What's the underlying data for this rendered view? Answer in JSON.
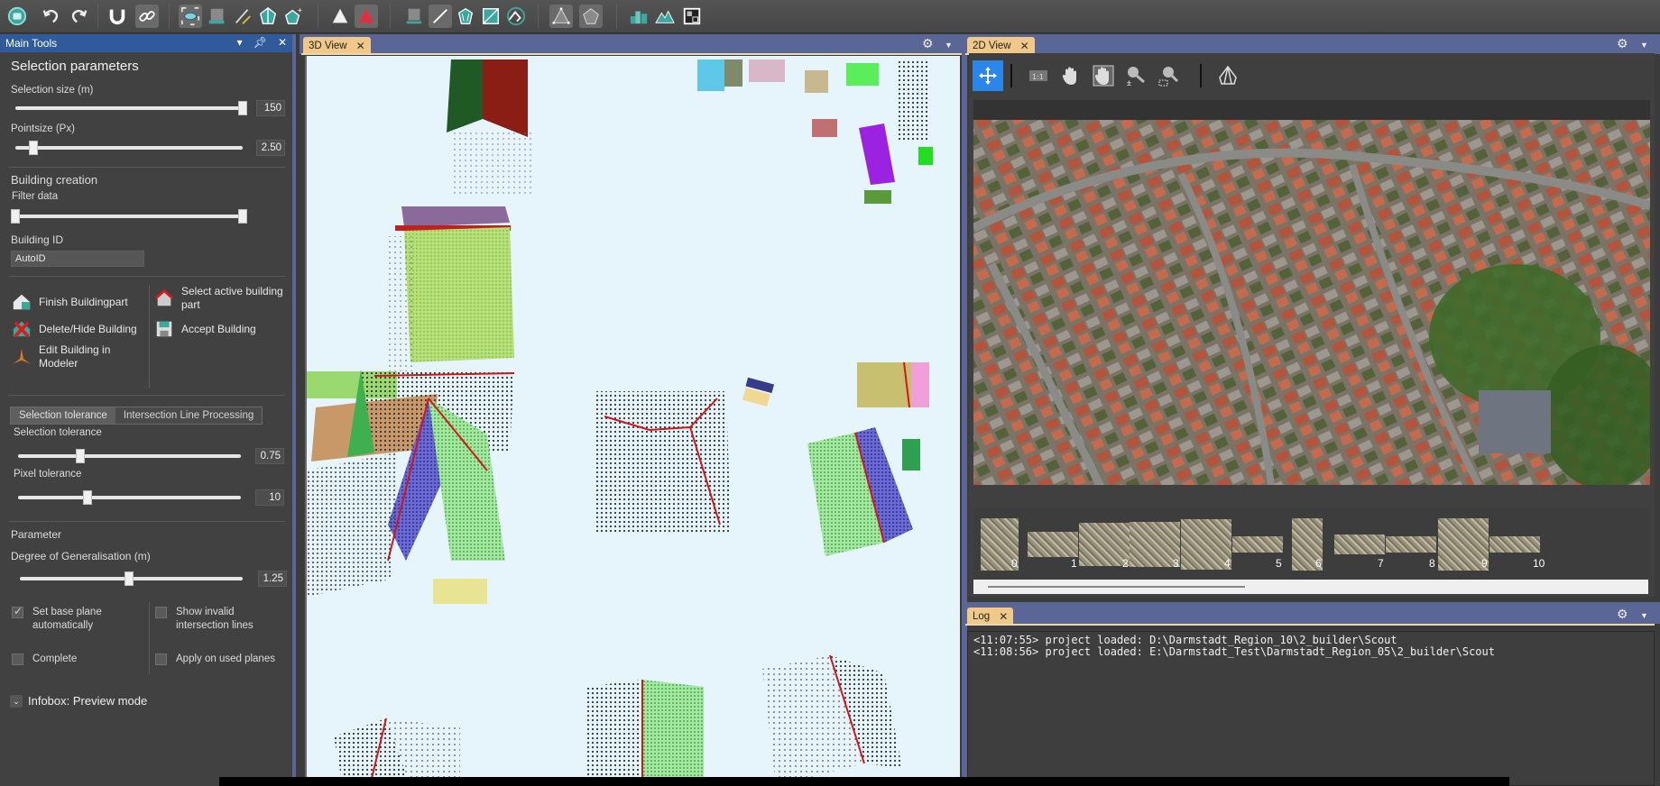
{
  "toolbar": {
    "buttons": [
      {
        "name": "app-logo",
        "icon": "sphere-icon"
      },
      {
        "name": "undo",
        "icon": "undo-icon"
      },
      {
        "name": "redo",
        "icon": "redo-icon"
      },
      {
        "name": "snap",
        "icon": "magnet-icon"
      },
      {
        "name": "link",
        "icon": "link-icon"
      },
      {
        "name": "select-region",
        "icon": "select-region-icon"
      },
      {
        "name": "plane-tool",
        "icon": "plane-icon"
      },
      {
        "name": "line-tool",
        "icon": "line-icon"
      },
      {
        "name": "roof-polygon",
        "icon": "pentagon-split-icon"
      },
      {
        "name": "add-polygon",
        "icon": "pentagon-add-icon"
      },
      {
        "name": "triangle-white",
        "icon": "triangle-icon"
      },
      {
        "name": "triangle-red",
        "icon": "triangle-red-icon"
      },
      {
        "name": "layer-box",
        "icon": "box-icon"
      },
      {
        "name": "edge-line",
        "icon": "edge-icon"
      },
      {
        "name": "shield-polygon",
        "icon": "shield-icon"
      },
      {
        "name": "split-square",
        "icon": "split-square-icon"
      },
      {
        "name": "roof-circle",
        "icon": "roof-circle-icon"
      },
      {
        "name": "triangle-vertices",
        "icon": "triangle-vertices-icon"
      },
      {
        "name": "pentagon-gray",
        "icon": "pentagon-icon"
      },
      {
        "name": "city-model",
        "icon": "buildings-icon"
      },
      {
        "name": "terrain",
        "icon": "mountain-icon"
      },
      {
        "name": "floorplan",
        "icon": "floorplan-icon"
      }
    ]
  },
  "main_tools": {
    "title": "Main Tools",
    "selection_parameters": {
      "title": "Selection parameters",
      "selection_size": {
        "label": "Selection size (m)",
        "value": "150",
        "fraction": 1.0
      },
      "pointsize": {
        "label": "Pointsize (Px)",
        "value": "2.50",
        "fraction": 0.08
      }
    },
    "building_creation": {
      "title": "Building creation",
      "filter_label": "Filter data",
      "filter_range": [
        0.0,
        1.0
      ],
      "building_id_label": "Building ID",
      "building_id_value": "AutoID",
      "actions": {
        "finish": "Finish Buildingpart",
        "delete": "Delete/Hide Building",
        "edit": "Edit Building in Modeler",
        "select_active": "Select active building part",
        "accept": "Accept Building"
      }
    },
    "tolerance_tabs": [
      "Selection tolerance",
      "Intersection Line Processing"
    ],
    "selection_tolerance": {
      "label": "Selection tolerance",
      "value": "0.75",
      "fraction": 0.28
    },
    "pixel_tolerance": {
      "label": "Pixel tolerance",
      "value": "10",
      "fraction": 0.31
    },
    "parameter": {
      "title": "Parameter",
      "generalisation": {
        "label": "Degree of Generalisation (m)",
        "value": "1.25",
        "fraction": 0.49
      }
    },
    "checkboxes": {
      "set_base_plane": {
        "label": "Set base plane automatically",
        "checked": true
      },
      "show_invalid": {
        "label": "Show invalid intersection lines",
        "checked": false
      },
      "complete": {
        "label": "Complete",
        "checked": false
      },
      "apply_used": {
        "label": "Apply on used planes",
        "checked": false
      }
    },
    "infobox": "Infobox: Preview mode"
  },
  "view3d": {
    "tab_label": "3D View"
  },
  "view2d": {
    "tab_label": "2D View",
    "tools": [
      "move-icon",
      "zoom-1to1-icon",
      "pan-hand-icon",
      "pan-hand-frame-icon",
      "zoom-plusminus-icon",
      "zoom-region-icon",
      "perspective-icon"
    ],
    "thumbnails": [
      "0",
      "1",
      "2",
      "3",
      "4",
      "5",
      "6",
      "7",
      "8",
      "9",
      "10"
    ]
  },
  "log": {
    "tab_label": "Log",
    "lines": [
      "<11:07:55> project loaded: D:\\Darmstadt_Region_10\\2_builder\\Scout",
      "<11:08:56> project loaded: E:\\Darmstadt_Test\\Darmstadt_Region_05\\2_builder\\Scout"
    ]
  },
  "colors": {
    "panel_header": "#2f5a9b",
    "dock_strip": "#5a6696",
    "tab_active": "#f0c888",
    "view3d_bg": "#e6f5fc",
    "accent_blue": "#2a86e8",
    "edge_red": "#e0201c"
  }
}
